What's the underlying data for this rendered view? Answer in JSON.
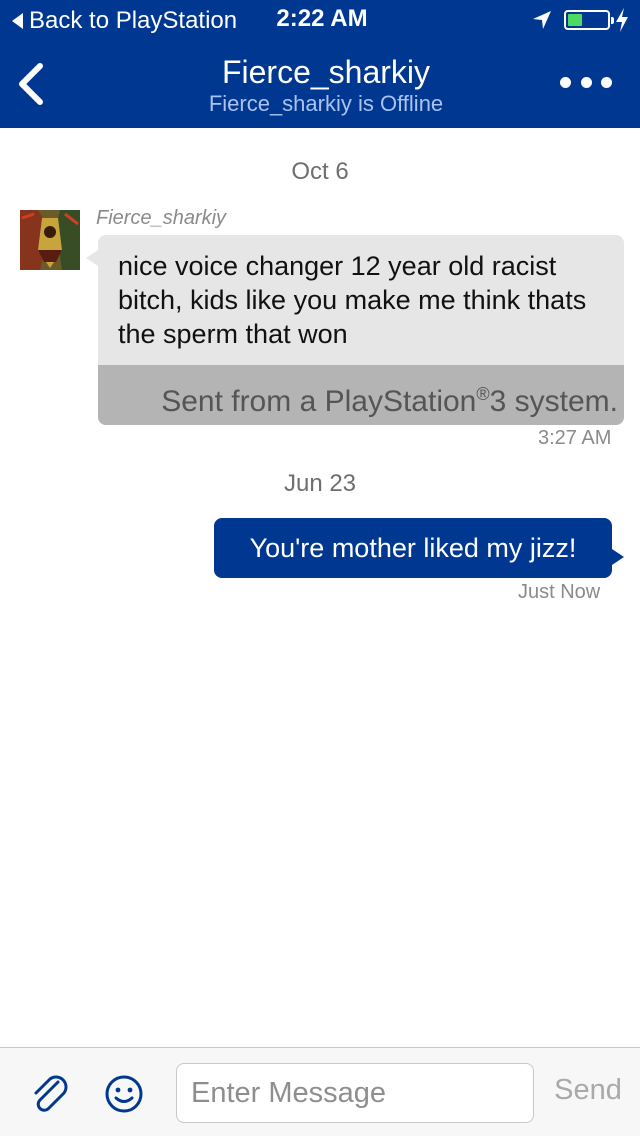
{
  "status_bar": {
    "back_label": "Back to PlayStation",
    "time": "2:22 AM",
    "battery_color": "#4cd964"
  },
  "header": {
    "title": "Fierce_sharkiy",
    "subtitle": "Fierce_sharkiy is Offline",
    "back_icon": "chevron-left-icon",
    "more_icon": "more-dots-icon",
    "background_color": "#003791"
  },
  "thread": {
    "groups": [
      {
        "date": "Oct 6",
        "message": {
          "sender": "Fierce_sharkiy",
          "text": "nice voice changer 12 year old racist bitch, kids like you make me think thats the sperm that won",
          "footer_prefix": "Sent from a PlayStation",
          "footer_reg": "®",
          "footer_suffix": "3 system.",
          "time": "3:27 AM"
        }
      },
      {
        "date": "Jun 23",
        "message": {
          "text": "You're mother liked my jizz!",
          "time": "Just Now"
        }
      }
    ]
  },
  "composer": {
    "placeholder": "Enter Message",
    "send_label": "Send",
    "attach_icon": "paperclip-icon",
    "emoji_icon": "smiley-icon"
  }
}
